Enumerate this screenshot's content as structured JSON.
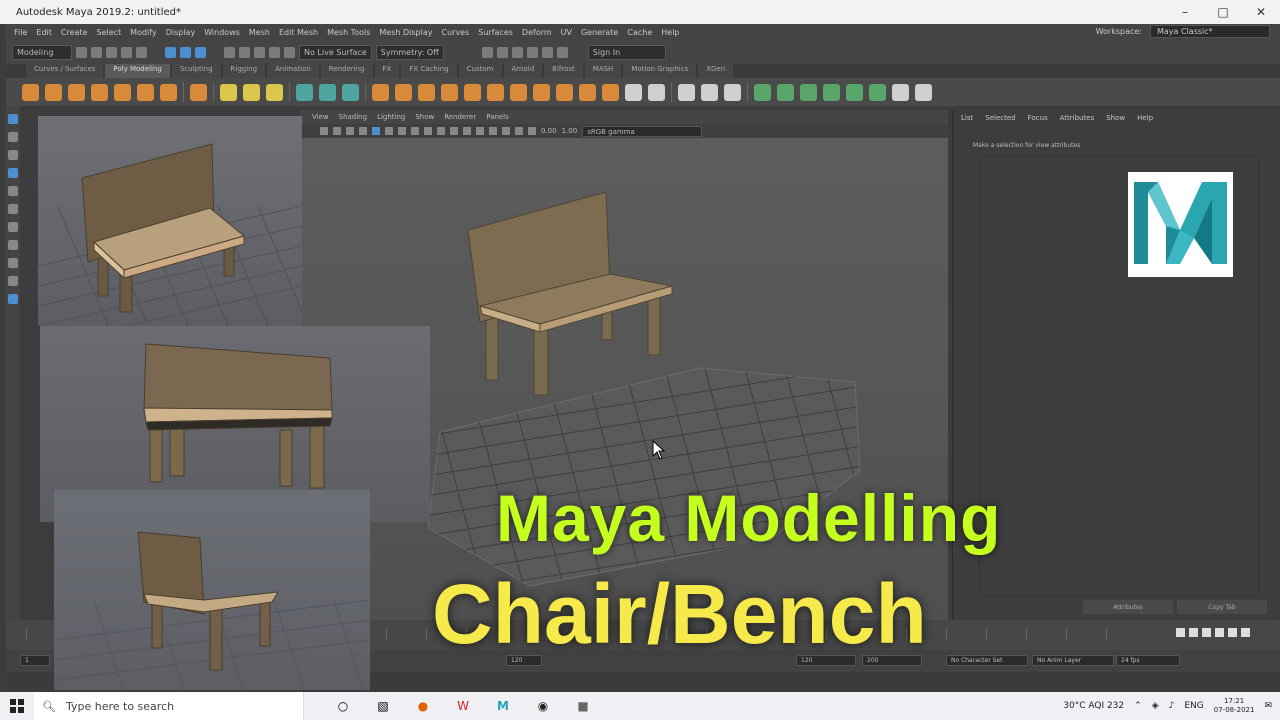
{
  "window": {
    "title": "Autodesk Maya 2019.2: untitled*",
    "controls": [
      "–",
      "□",
      "✕"
    ]
  },
  "menubar": {
    "items": [
      "File",
      "Edit",
      "Create",
      "Select",
      "Modify",
      "Display",
      "Windows",
      "Mesh",
      "Edit Mesh",
      "Mesh Tools",
      "Mesh Display",
      "Curves",
      "Surfaces",
      "Deform",
      "UV",
      "Generate",
      "Cache",
      "Help"
    ],
    "workspace_label": "Workspace:",
    "workspace_value": "Maya Classic*"
  },
  "statusline": {
    "mode": "Modeling",
    "live_surface": "No Live Surface",
    "symmetry": "Symmetry: Off",
    "sign_in": "Sign In"
  },
  "shelf_tabs": [
    "Curves / Surfaces",
    "Poly Modeling",
    "Sculpting",
    "Rigging",
    "Animation",
    "Rendering",
    "FX",
    "FX Caching",
    "Custom",
    "Arnold",
    "Bifrost",
    "MASH",
    "Motion Graphics",
    "XGen"
  ],
  "shelf_active": "Poly Modeling",
  "viewport": {
    "menu": [
      "View",
      "Shading",
      "Lighting",
      "Show",
      "Renderer",
      "Panels"
    ],
    "exposure": "0.00",
    "gamma": "1.00",
    "colorspace": "sRGB gamma"
  },
  "attribute_editor": {
    "menu": [
      "List",
      "Selected",
      "Focus",
      "Attributes",
      "Show",
      "Help"
    ],
    "message": "Make a selection for view attributes",
    "buttons": [
      "Attributes",
      "Copy Tab"
    ]
  },
  "range": {
    "start": "1",
    "playback_start": "120",
    "playback_end": "120",
    "end": "200",
    "character_set": "No Character Set",
    "anim_layer": "No Anim Layer",
    "fps": "24 fps"
  },
  "overlay": {
    "line1": "Maya Modelling",
    "line2": "Chair/Bench"
  },
  "taskbar": {
    "search_placeholder": "Type here to search",
    "weather": "30°C  AQI 232",
    "language": "ENG",
    "time": "17:21",
    "date": "07-08-2021"
  },
  "colors": {
    "overlay_line1": "#c5ff1e",
    "overlay_line2": "#f6ea4a",
    "maya_teal": "#2aa6b0",
    "maya_blue": "#4b8fd0"
  }
}
